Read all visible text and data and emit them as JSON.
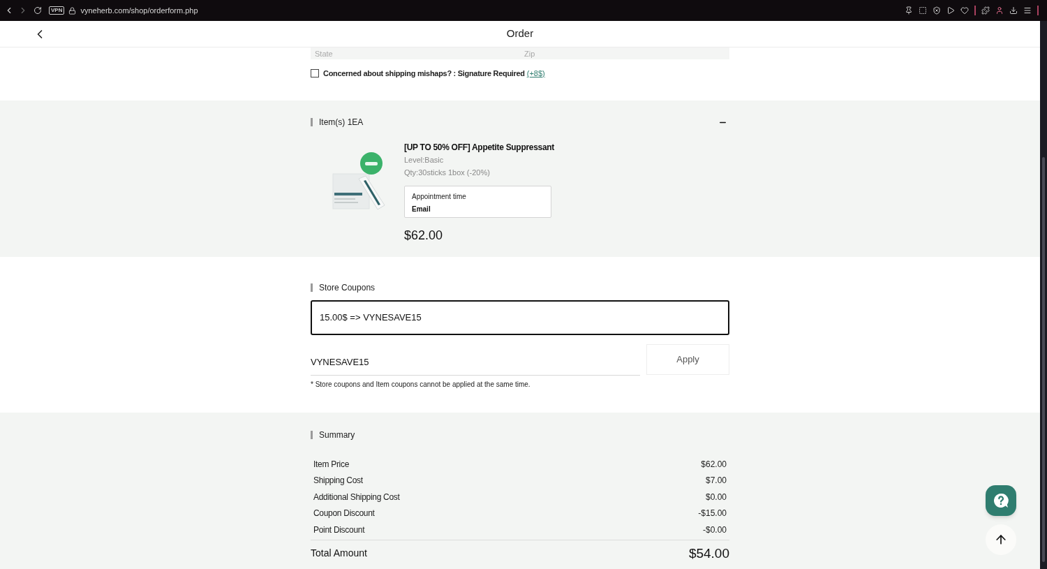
{
  "browser": {
    "vpn": "VPN",
    "url": "vyneherb.com/shop/orderform.php"
  },
  "header": {
    "title": "Order"
  },
  "address": {
    "fields": [
      {
        "placeholder": "State"
      },
      {
        "placeholder": "Zip"
      }
    ]
  },
  "signature": {
    "checked": false,
    "label": "Concerned about shipping mishaps? : Signature Required",
    "link": "(+8$)"
  },
  "items": {
    "title": "Item(s) 1EA",
    "expanded": true,
    "products": [
      {
        "name": "[UP TO 50% OFF] Appetite Suppressant",
        "level": "Level:Basic",
        "qty": "Qty:30sticks 1box (-20%)",
        "option_label": "Appointment time",
        "option_value": "Email",
        "price": "$62.00"
      }
    ]
  },
  "coupons": {
    "title": "Store Coupons",
    "selected_coupon": "15.00$ => VYNESAVE15",
    "code_value": "VYNESAVE15",
    "apply": "Apply",
    "note": "* Store coupons and Item coupons cannot be applied at the same time."
  },
  "summary": {
    "title": "Summary",
    "rows": [
      {
        "label": "Item Price",
        "value": "$62.00"
      },
      {
        "label": "Shipping Cost",
        "value": "$7.00"
      },
      {
        "label": "Additional Shipping Cost",
        "value": "$0.00"
      },
      {
        "label": "Coupon Discount",
        "value": "-$15.00"
      },
      {
        "label": "Point Discount",
        "value": "-$0.00"
      }
    ],
    "total_label": "Total Amount",
    "total_value": "$54.00"
  }
}
